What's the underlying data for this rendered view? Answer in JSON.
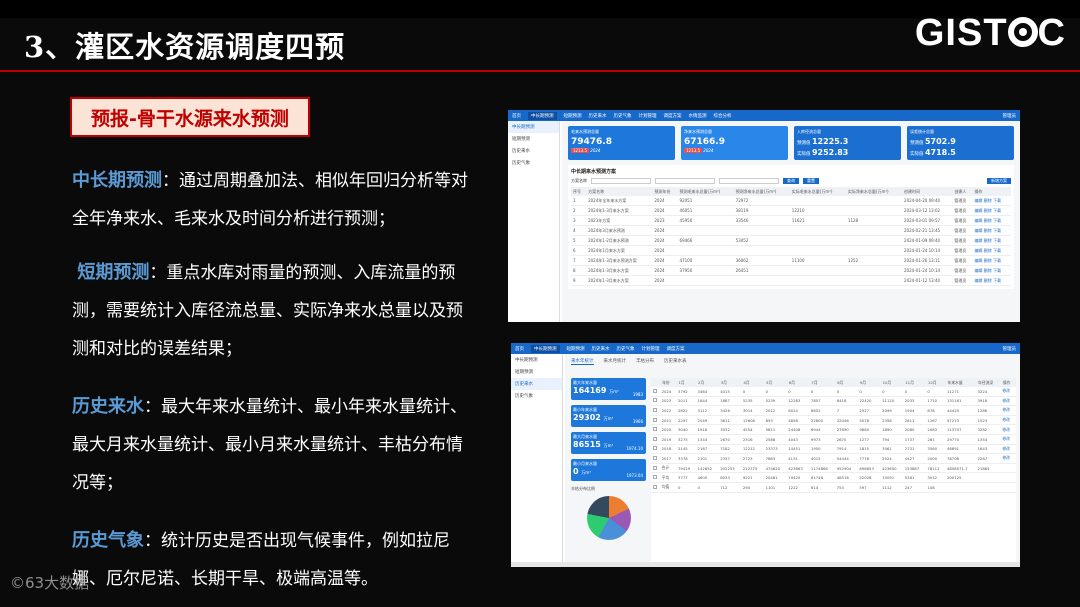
{
  "slide": {
    "title": "3、灌区水资源调度四预",
    "logo": {
      "pre": "GIST",
      "post": "C"
    },
    "tag": "预报-骨干水源来水预测",
    "paragraphs": [
      {
        "key": "中长期预测",
        "text": "：通过周期叠加法、相似年回归分析等对全年净来水、毛来水及时间分析进行预测；"
      },
      {
        "key": "短期预测",
        "text": "：重点水库对雨量的预测、入库流量的预测，需要统计入库径流总量、实际净来水总量以及预测和对比的误差结果；"
      },
      {
        "key": "历史来水",
        "text": "：最大年来水量统计、最小年来水量统计、最大月来水量统计、最小月来水量统计、丰枯分布情况等；"
      },
      {
        "key": "历史气象",
        "text": "：统计历史是否出现气候事件，例如拉尼娜、厄尔尼诺、长期干旱、极端高温等。"
      }
    ],
    "watermark": "©63大数据"
  },
  "shot1": {
    "nav": [
      "首页",
      "中长期预测",
      "短期预测",
      "历史来水",
      "历史气象",
      "计划管理",
      "调度方案",
      "水情监测",
      "综合分析"
    ],
    "user": "管理员",
    "side": [
      "中长期预测",
      "短期预测",
      "历史来水",
      "历史气象"
    ],
    "cards": [
      {
        "label": "毛来水预测总量",
        "value": "79476.8",
        "sub": "1213.5",
        "sub2": "2024"
      },
      {
        "label": "净来水预测总量",
        "value": "67166.9",
        "sub": "1213.5",
        "sub2": "2024"
      },
      {
        "label": "入库径流总量",
        "row1": "预测值",
        "v1": "12225.3",
        "row2": "实际值",
        "v2": "9252.83"
      },
      {
        "label": "误差统计总量",
        "row1": "预测值",
        "v1": "5702.9",
        "row2": "实际值",
        "v2": "4718.5"
      }
    ],
    "panel_title": "中长期来水预测方案",
    "filter_label": "方案名称",
    "filter_btn": "查询",
    "reset_btn": "重置",
    "add_btn": "新增方案",
    "headers": [
      "序号",
      "方案名称",
      "预测年份",
      "预测毛来水总量(万m³)",
      "预测净来水总量(万m³)",
      "实际毛来水总量(万m³)",
      "实际净来水总量(万m³)",
      "创建时间",
      "创建人",
      "操作"
    ],
    "rows": [
      [
        "1",
        "2024年全年来水方案",
        "2024",
        "92051",
        "72972",
        "",
        "",
        "2024-04-20 09:40",
        "管理员",
        "编辑 删除 下载"
      ],
      [
        "2",
        "2024年1-3月来水方案",
        "2024",
        "46051",
        "38119",
        "12210",
        "",
        "2024-03-12 13:02",
        "管理员",
        "编辑 删除 下载"
      ],
      [
        "3",
        "2023年方案",
        "2023",
        "45950",
        "33546",
        "11621",
        "1128",
        "2024-03-01 09:57",
        "管理员",
        "编辑 删除 下载"
      ],
      [
        "4",
        "2024年3月来水预测",
        "2024",
        "",
        "",
        "",
        "",
        "2024-02-21 13:45",
        "管理员",
        "编辑 删除 下载"
      ],
      [
        "5",
        "2024年1-2月来水预测",
        "2024",
        "69466",
        "53452",
        "",
        "",
        "2024-01-09 09:40",
        "管理员",
        "编辑 删除 下载"
      ],
      [
        "6",
        "2024年1月来水方案",
        "2024",
        "",
        "",
        "",
        "",
        "2024-01-24 10:14",
        "管理员",
        "编辑 删除 下载"
      ],
      [
        "7",
        "2024年1-3月来水预测方案",
        "2024",
        "47100",
        "36062",
        "11100",
        "1252",
        "2024-01-26 13:11",
        "管理员",
        "编辑 删除 下载"
      ],
      [
        "8",
        "2024年1-3月来水方案",
        "2024",
        "37950",
        "26451",
        "",
        "",
        "2024-01-24 10:14",
        "管理员",
        "编辑 删除 下载"
      ],
      [
        "9",
        "2024年1-3月来水方案",
        "2024",
        "",
        "",
        "",
        "",
        "2024-01-12 13:40",
        "管理员",
        "编辑 删除 下载"
      ]
    ]
  },
  "shot2": {
    "tabs": [
      "来水年统计",
      "来水月统计",
      "丰枯分布",
      "历史来水表"
    ],
    "boxes": [
      {
        "label": "最大年来水量",
        "value": "164169",
        "unit": "万m³",
        "year": "1983"
      },
      {
        "label": "最小年来水量",
        "value": "29302",
        "unit": "万m³",
        "year": "1966"
      },
      {
        "label": "最大月来水量",
        "value": "86515",
        "unit": "万m³",
        "year": "1974.10"
      },
      {
        "label": "最小月来水量",
        "value": "0",
        "unit": "万m³",
        "year": "1973.04"
      }
    ],
    "pie_title": "丰枯分布比例",
    "headers": [
      "",
      "年份",
      "1月",
      "2月",
      "3月",
      "4月",
      "5月",
      "6月",
      "7月",
      "8月",
      "9月",
      "10月",
      "11月",
      "12月",
      "年来水量",
      "年径流深",
      "操作"
    ],
    "rows": [
      [
        "2024",
        "3792",
        "3464",
        "4015",
        "0",
        "0",
        "0",
        "0",
        "0",
        "0",
        "0",
        "0",
        "0",
        "11271",
        "3224",
        "修改"
      ],
      [
        "2023",
        "2011",
        "1844",
        "1887",
        "5235",
        "5239",
        "12283",
        "7857",
        "8418",
        "22420",
        "11120",
        "2033",
        "1710",
        "131161",
        "3918",
        "修改"
      ],
      [
        "2022",
        "2822",
        "3112",
        "3426",
        "3014",
        "2012",
        "6024",
        "8652",
        "7",
        "2527",
        "2099",
        "1904",
        "878",
        "44425",
        "1286",
        "修改"
      ],
      [
        "2021",
        "2297",
        "2049",
        "3811",
        "12608",
        "893",
        "4858",
        "22800",
        "32046",
        "5578",
        "2358",
        "2811",
        "1267",
        "97273",
        "1523",
        "修改"
      ],
      [
        "2020",
        "3040",
        "1918",
        "3532",
        "4554",
        "5811",
        "24408",
        "6944",
        "27690",
        "9880",
        "1890",
        "2080",
        "2083",
        "113707",
        "3282",
        "修改"
      ],
      [
        "2019",
        "3275",
        "1344",
        "2670",
        "2316",
        "2588",
        "4043",
        "9973",
        "2670",
        "1277",
        "794",
        "1737",
        "281",
        "29770",
        "1354",
        "修改"
      ],
      [
        "2018",
        "2145",
        "2167",
        "7182",
        "12212",
        "23373",
        "14451",
        "1950",
        "7914",
        "1815",
        "3561",
        "2731",
        "3560",
        "46891",
        "1643",
        "修改"
      ],
      [
        "2017",
        "3378",
        "2101",
        "2337",
        "2723",
        "7883",
        "4131",
        "4015",
        "54444",
        "7776",
        "2524",
        "4427",
        "2000",
        "78708",
        "2287",
        "修改"
      ],
      [
        "合计",
        "79419",
        "142852",
        "202253",
        "222375",
        "474620",
        "423863",
        "1174866",
        "952904",
        "896853",
        "423650",
        "153887",
        "78112",
        "4808571.7",
        "21864",
        ""
      ],
      [
        "平均",
        "3777",
        "4600",
        "6033",
        "9221",
        "20481",
        "19420",
        "61746",
        "48516",
        "52028",
        "15091",
        "5381",
        "3012",
        "200125",
        "",
        ""
      ],
      [
        "均值",
        "0",
        "0",
        "712",
        "290",
        "1101",
        "1222",
        "614",
        "753",
        "597",
        "1112",
        "247",
        "108",
        "",
        "",
        ""
      ]
    ]
  }
}
